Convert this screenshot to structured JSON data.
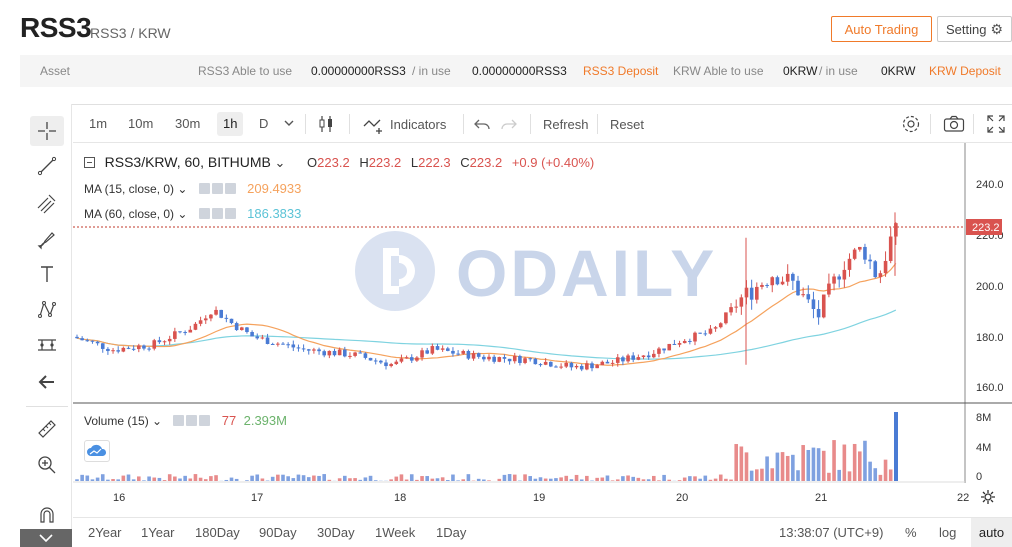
{
  "header": {
    "symbol": "RSS3",
    "pair": "RSS3 / KRW",
    "auto_trading_label": "Auto Trading",
    "setting_label": "Setting"
  },
  "asset_bar": {
    "asset_label": "Asset",
    "rss3_able_label": "RSS3 Able to use",
    "rss3_able_value": "0.00000000RSS3",
    "in_use_label": "/ in use",
    "rss3_in_use_value": "0.00000000RSS3",
    "rss3_deposit_label": "RSS3 Deposit",
    "krw_able_label": "KRW Able to use",
    "krw_able_value": "0KRW",
    "krw_in_use_label": "/ in use",
    "krw_in_use_value": "0KRW",
    "krw_deposit_label": "KRW Deposit"
  },
  "toolbar": {
    "timeframes": [
      "1m",
      "10m",
      "30m",
      "1h",
      "D"
    ],
    "active_timeframe": "1h",
    "indicators_label": "Indicators",
    "refresh_label": "Refresh",
    "reset_label": "Reset"
  },
  "legend": {
    "title": "RSS3/KRW, 60, BITHUMB",
    "o_label": "O",
    "o_value": "223.2",
    "h_label": "H",
    "h_value": "223.2",
    "l_label": "L",
    "l_value": "222.3",
    "c_label": "C",
    "c_value": "223.2",
    "change": "+0.9 (+0.40%)",
    "ma15_label": "MA (15, close, 0)",
    "ma15_value": "209.4933",
    "ma60_label": "MA (60, close, 0)",
    "ma60_value": "186.3833",
    "volume_label": "Volume (15)",
    "volume_value": "77",
    "volume_ma_value": "2.393M"
  },
  "price_axis": [
    "240.0",
    "220.0",
    "200.0",
    "180.0",
    "160.0"
  ],
  "last_price": "223.2",
  "volume_axis": [
    "8M",
    "4M",
    "0"
  ],
  "time_axis": [
    "16",
    "17",
    "18",
    "19",
    "20",
    "21",
    "22"
  ],
  "watermark": "ODAILY",
  "bottom": {
    "ranges": [
      "2Year",
      "1Year",
      "180Day",
      "90Day",
      "30Day",
      "1Week",
      "1Day"
    ],
    "clock": "13:38:07 (UTC+9)",
    "percent_label": "%",
    "log_label": "log",
    "auto_label": "auto"
  },
  "colors": {
    "up": "#d9534f",
    "down": "#4a7bd4",
    "accent": "#f07a2a",
    "ma15": "#f5a25d",
    "ma60": "#7fd3e0"
  },
  "chart_data": {
    "type": "candlestick",
    "title": "RSS3/KRW, 60, BITHUMB",
    "y_ticks": [
      240,
      220,
      200,
      180,
      160
    ],
    "x_ticks": [
      "16",
      "17",
      "18",
      "19",
      "20",
      "21",
      "22"
    ],
    "series": [
      {
        "name": "MA (15, close, 0)",
        "last": 209.4933
      },
      {
        "name": "MA (60, close, 0)",
        "last": 186.3833
      },
      {
        "name": "Volume (15)",
        "last": 77,
        "ma": "2.393M"
      }
    ],
    "last_price": 223.2
  }
}
